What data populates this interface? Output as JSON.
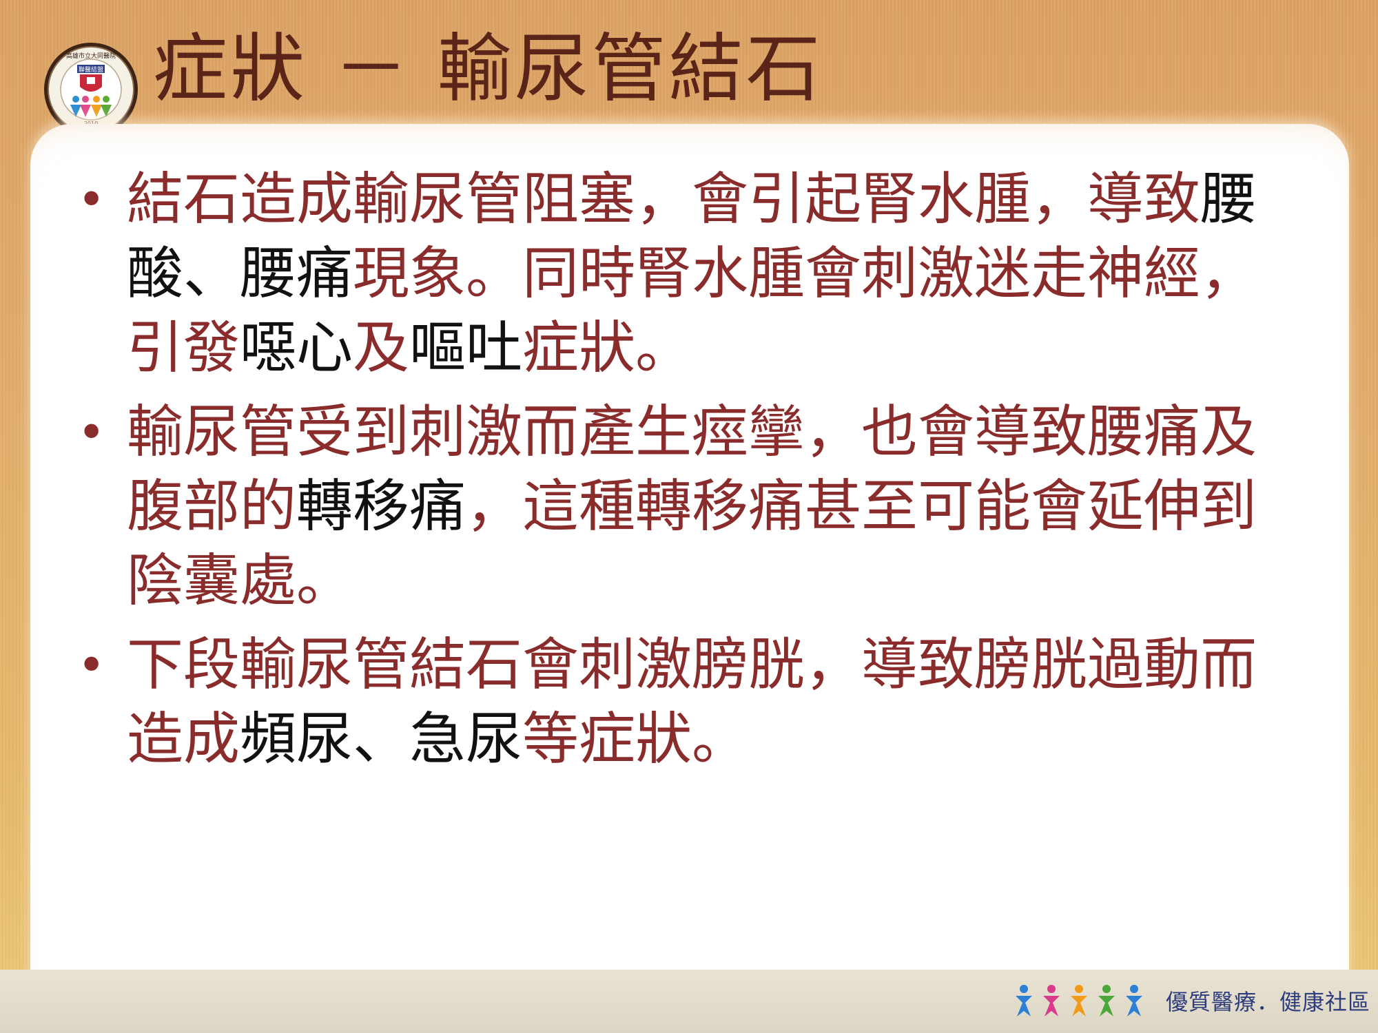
{
  "header": {
    "title": "症狀 －  輸尿管結石"
  },
  "logo": {
    "seal_text": "高雄市立大同醫院",
    "center_text": "聯醫結盟",
    "year": "2010",
    "icon": "hospital-logo-icon"
  },
  "bullets": [
    {
      "segments": [
        {
          "text": "結石造成輸尿管阻塞，會引起腎水腫，導致",
          "color": "red"
        },
        {
          "text": "腰酸、腰痛",
          "color": "black"
        },
        {
          "text": "現象。同時腎水腫會刺激迷走神經，引發",
          "color": "red"
        },
        {
          "text": "噁心",
          "color": "black"
        },
        {
          "text": "及",
          "color": "red"
        },
        {
          "text": "嘔吐",
          "color": "black"
        },
        {
          "text": "症狀。",
          "color": "red"
        }
      ]
    },
    {
      "segments": [
        {
          "text": "輸尿管受到刺激而產生痙攣，也會導致腰痛及腹部的",
          "color": "red"
        },
        {
          "text": "轉移痛",
          "color": "black"
        },
        {
          "text": "，這種轉移痛甚至可能會延伸到陰囊處。",
          "color": "red"
        }
      ]
    },
    {
      "segments": [
        {
          "text": "下段輸尿管結石會刺激膀胱，導致膀胱過動而造成",
          "color": "red"
        },
        {
          "text": "頻尿、急尿",
          "color": "black"
        },
        {
          "text": "等症狀。",
          "color": "red"
        }
      ]
    }
  ],
  "footer": {
    "slogan": "優質醫療．健康社區",
    "icon": "people-figures-icon"
  },
  "colors": {
    "title": "#5a2418",
    "red_text": "#8b2c2c",
    "black_text": "#111111",
    "background": "#e2ad6a"
  }
}
